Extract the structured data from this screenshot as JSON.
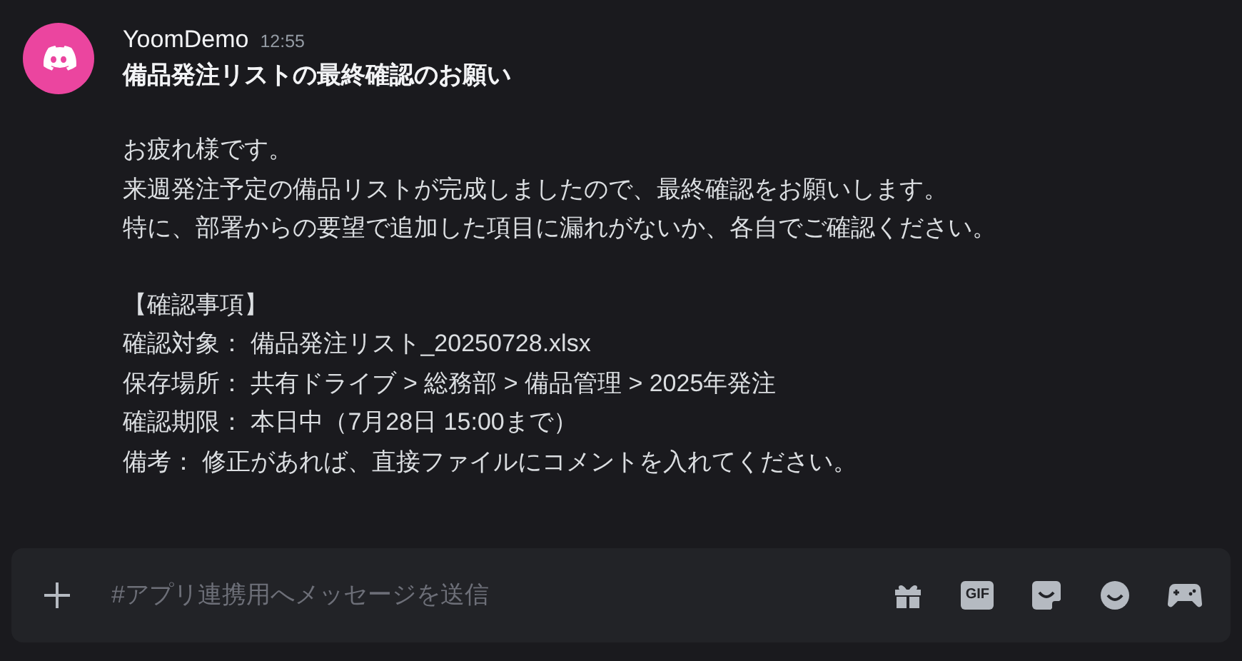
{
  "message": {
    "author": "YoomDemo",
    "time": "12:55",
    "title": "備品発注リストの最終確認のお願い",
    "paragraphs": [
      [
        "お疲れ様です。",
        "来週発注予定の備品リストが完成しましたので、最終確認をお願いします。",
        "特に、部署からの要望で追加した項目に漏れがないか、各自でご確認ください。"
      ],
      [
        "【確認事項】",
        "確認対象： 備品発注リスト_20250728.xlsx",
        "保存場所： 共有ドライブ > 総務部 > 備品管理 > 2025年発注",
        "確認期限： 本日中（7月28日 15:00まで）",
        "備考： 修正があれば、直接ファイルにコメントを入れてください。"
      ]
    ]
  },
  "composer": {
    "placeholder": "#アプリ連携用へメッセージを送信",
    "gif_label": "GIF"
  }
}
